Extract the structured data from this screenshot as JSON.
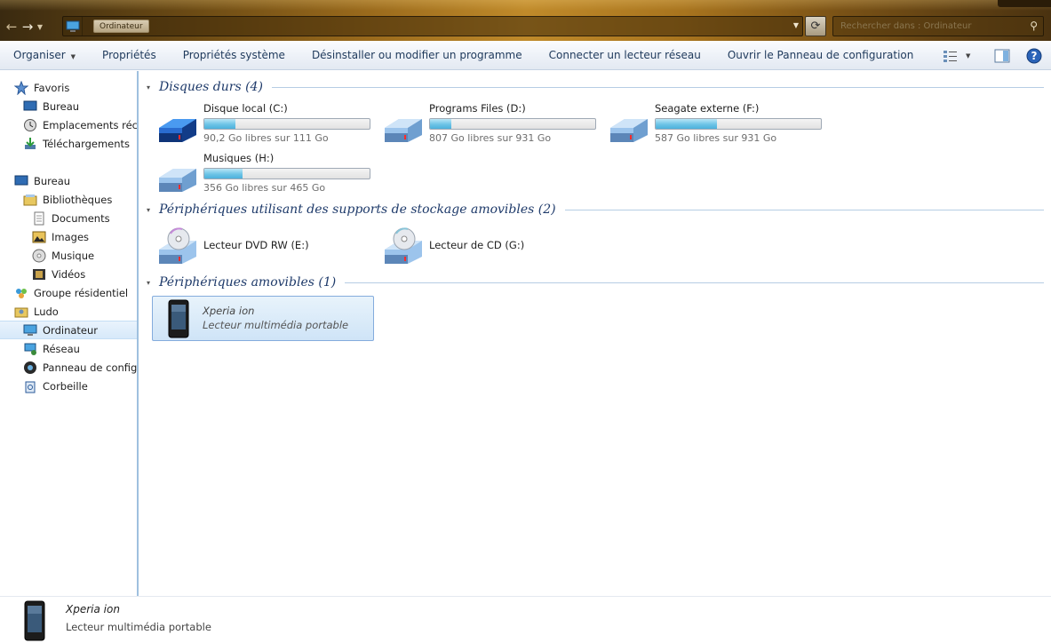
{
  "titlebar": {
    "breadcrumb": "Ordinateur",
    "search_placeholder": "Rechercher dans : Ordinateur"
  },
  "toolbar": {
    "items": [
      {
        "label": "Organiser",
        "has_caret": true
      },
      {
        "label": "Propriétés"
      },
      {
        "label": "Propriétés système"
      },
      {
        "label": "Désinstaller ou modifier un programme"
      },
      {
        "label": "Connecter un lecteur réseau"
      },
      {
        "label": "Ouvrir le Panneau de configuration"
      }
    ]
  },
  "sidebar": {
    "items": [
      {
        "label": "Favoris",
        "icon": "star-icon"
      },
      {
        "label": "Bureau",
        "icon": "desktop-icon"
      },
      {
        "label": "Emplacements récents",
        "icon": "recent-places-icon"
      },
      {
        "label": "Téléchargements",
        "icon": "downloads-icon"
      },
      {
        "label": "Bureau",
        "icon": "desktop-icon"
      },
      {
        "label": "Bibliothèques",
        "icon": "libraries-icon"
      },
      {
        "label": "Documents",
        "icon": "documents-icon"
      },
      {
        "label": "Images",
        "icon": "images-icon"
      },
      {
        "label": "Musique",
        "icon": "music-icon"
      },
      {
        "label": "Vidéos",
        "icon": "videos-icon"
      },
      {
        "label": "Groupe résidentiel",
        "icon": "homegroup-icon"
      },
      {
        "label": "Ludo",
        "icon": "user-folder-icon"
      },
      {
        "label": "Ordinateur",
        "icon": "computer-icon",
        "selected": true
      },
      {
        "label": "Réseau",
        "icon": "network-icon"
      },
      {
        "label": "Panneau de configuration",
        "icon": "control-panel-icon"
      },
      {
        "label": "Corbeille",
        "icon": "recycle-bin-icon"
      }
    ]
  },
  "groups": {
    "hard_disks": {
      "title": "Disques durs (4)",
      "drives": [
        {
          "name": "Disque local (C:)",
          "free_text": "90,2 Go libres sur 111 Go",
          "used_fraction": 0.19,
          "system": true
        },
        {
          "name": "Programs Files (D:)",
          "free_text": "807 Go libres sur 931 Go",
          "used_fraction": 0.13
        },
        {
          "name": "Seagate externe (F:)",
          "free_text": "587 Go libres sur 931 Go",
          "used_fraction": 0.37
        },
        {
          "name": "Musiques (H:)",
          "free_text": "356 Go libres sur 465 Go",
          "used_fraction": 0.23
        }
      ]
    },
    "removable_storage": {
      "title": "Périphériques utilisant des supports de stockage amovibles (2)",
      "drives": [
        {
          "name": "Lecteur DVD RW (E:)"
        },
        {
          "name": "Lecteur de CD (G:)"
        }
      ]
    },
    "removable_devices": {
      "title": "Périphériques amovibles (1)",
      "device": {
        "name": "Xperia ion",
        "type": "Lecteur multimédia portable"
      }
    }
  },
  "details": {
    "name": "Xperia ion",
    "type": "Lecteur multimédia portable"
  },
  "colors": {
    "accent": "#1e3a6a",
    "selection": "#d7e9fa",
    "bar_fill": "#6dc4e6"
  }
}
